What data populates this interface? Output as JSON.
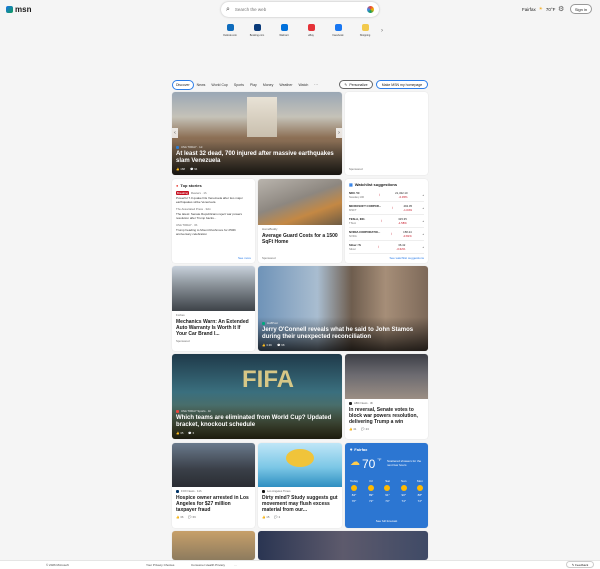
{
  "header": {
    "logo": "msn",
    "search_placeholder": "Search the web",
    "location": "Fairfax",
    "temp": "70°F",
    "signin": "Sign in"
  },
  "quicklinks": [
    {
      "label": "Outlook.com",
      "color": "#0f6cbd"
    },
    {
      "label": "Booking.com",
      "color": "#0a3a7a"
    },
    {
      "label": "Walmart",
      "color": "#0071dc"
    },
    {
      "label": "eBay",
      "color": "#e53238"
    },
    {
      "label": "Facebook",
      "color": "#1877f2"
    },
    {
      "label": "Shopping",
      "color": "#f2c94c"
    }
  ],
  "tabs": [
    "Discover",
    "News",
    "World Cup",
    "Sports",
    "Play",
    "Money",
    "Weather",
    "Watch",
    "···"
  ],
  "personalize": "Personalize",
  "make_home": "Make MSN my homepage",
  "hero": {
    "source": "USA TODAY · 1d",
    "title": "At least 32 dead, 700 injured after massive earthquakes slam Venezuela",
    "likes": "168",
    "comments": "94"
  },
  "sponsored": "Sponsored",
  "top_stories": {
    "header": "Top stories",
    "items": [
      {
        "source": "Reuters · 1h",
        "badge": "Breaking",
        "text": "Powerful 7.0 quake hits Venezuela after two major earthquakes strike Venezuela"
      },
      {
        "source": "The Associated Press · 32m",
        "text": "The latest: Senate Republicans reject war powers resolution after Trump backs..."
      },
      {
        "source": "USA TODAY · 3h",
        "text": "Trump heading to Mount Rushmore for 250th anniversary celebration"
      }
    ],
    "see_more": "See more"
  },
  "ad_gutter": {
    "source": "HomeBuddy",
    "title": "Average Guard Costs for a 1500 SqFt Home",
    "sponsored": "Sponsored"
  },
  "watchlist": {
    "header": "Watchlist suggestions",
    "rows": [
      {
        "sym": "NDX ^N",
        "sub": "Nasdaq 100",
        "price": "21,432.10",
        "chg": "-0.45%"
      },
      {
        "sym": "MICROSOFT CORPOR...",
        "sub": "MSFT",
        "price": "492.05",
        "chg": "-1.04%"
      },
      {
        "sym": "TESLA, INC.",
        "sub": "TSLA",
        "price": "315.35",
        "chg": "-1.58%"
      },
      {
        "sym": "NVIDIA CORPORATIO...",
        "sub": "NVDA",
        "price": "158.24",
        "chg": "-0.81%"
      },
      {
        "sym": "Silver ^S",
        "sub": "Silver",
        "price": "36.42",
        "chg": "-0.62%"
      }
    ],
    "see_all": "See watchlist suggestions"
  },
  "forbes": {
    "source": "Forbes",
    "title": "Mechanics Warn: An Extended Auto Warranty Is Worth It If Your Car Brand I...",
    "sponsored": "Sponsored"
  },
  "jerry": {
    "source": "HuffPost",
    "title": "Jerry O'Connell reveals what he said to John Stamos during their unexpected reconciliation",
    "likes": "3.3K",
    "comments": "98"
  },
  "fifa": {
    "source": "USA TODAY Sports · 1h",
    "title": "Which teams are eliminated from World Cup? Updated bracket, knockout schedule",
    "likes": "35",
    "comments": "6"
  },
  "senate": {
    "source": "ABC News · 3h",
    "title": "In reversal, Senate votes to block war powers resolution, delivering Trump a win",
    "likes": "41",
    "comments": "23"
  },
  "weather": {
    "location": "Fairfax",
    "temp": "70",
    "unit": "°F",
    "desc": "Scattered showers for the next few hours",
    "link": "See full forecast",
    "forecast": [
      {
        "day": "Today",
        "hi": "84°",
        "lo": "70°"
      },
      {
        "day": "Fri",
        "hi": "89°",
        "lo": "72°"
      },
      {
        "day": "Sat",
        "hi": "91°",
        "lo": "74°"
      },
      {
        "day": "Sun",
        "hi": "90°",
        "lo": "74°"
      },
      {
        "day": "Mon",
        "hi": "88°",
        "lo": "72°"
      }
    ]
  },
  "hospice": {
    "source": "FOX News · 11h",
    "title": "Hospice owner arrested in Los Angeles for $27 million taxpayer fraud",
    "likes": "36",
    "comments": "66"
  },
  "dirty": {
    "source": "Los Angeles Times",
    "title": "Dirty mind? Study suggests gut movement may flush excess material from our...",
    "likes": "15",
    "comments": "2"
  },
  "footer": {
    "copyright": "© 2026 Microsoft",
    "privacy": "Your Privacy Choices",
    "consumer": "Consumer Health Privacy",
    "more": "···",
    "feedback": "Feedback"
  }
}
